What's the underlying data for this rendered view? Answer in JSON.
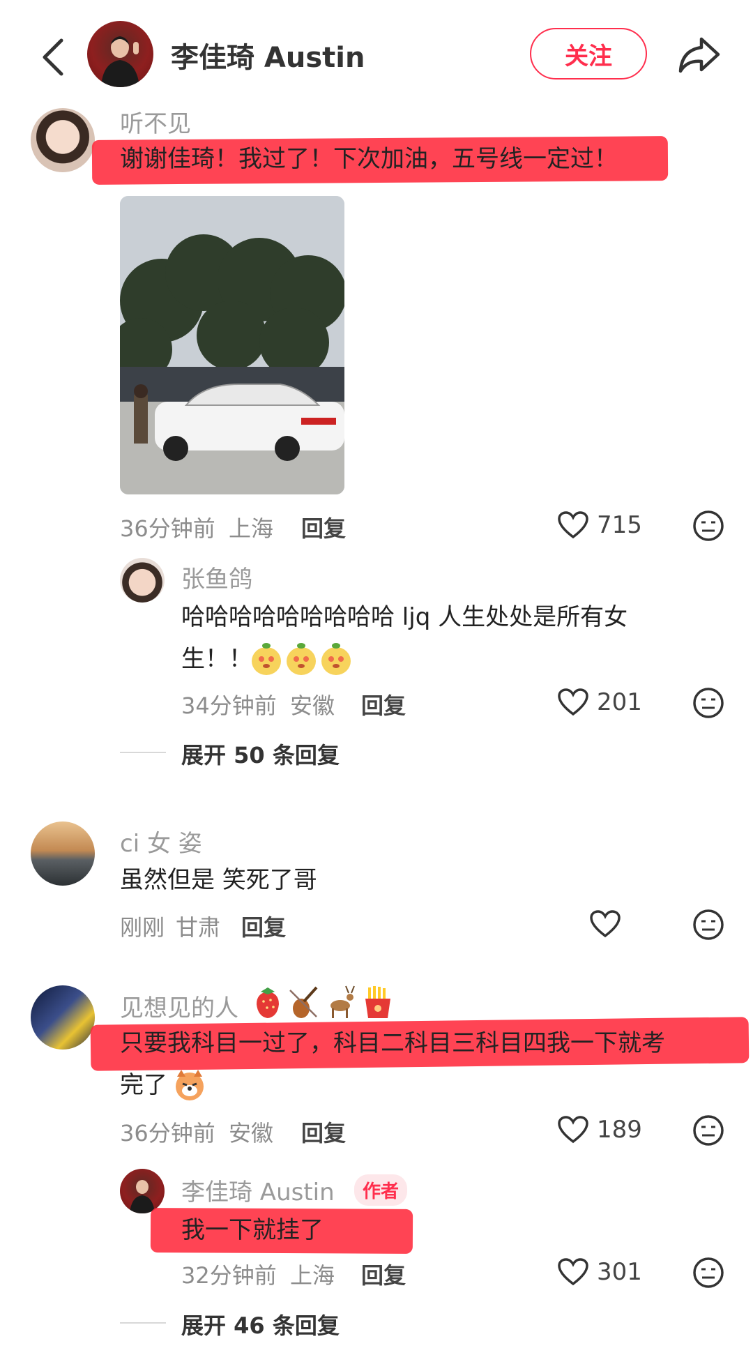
{
  "header": {
    "author_name": "李佳琦 Austin",
    "follow_label": "关注"
  },
  "colors": {
    "accent": "#ff2e4d",
    "highlight": "#ff2a3c"
  },
  "comments": [
    {
      "user": "听不见",
      "text": "谢谢佳琦！我过了！下次加油，五号线一定过！",
      "time": "36分钟前",
      "location": "上海",
      "reply_label": "回复",
      "likes": "715",
      "has_image": true,
      "replies": [
        {
          "user": "张鱼鸽",
          "text_line1": "哈哈哈哈哈哈哈哈哈 ljq 人生处处是所有女",
          "text_line2": "生！！",
          "time": "34分钟前",
          "location": "安徽",
          "reply_label": "回复",
          "likes": "201"
        }
      ],
      "expand_label": "展开 50 条回复"
    },
    {
      "user": "ci 女 姿",
      "text": "虽然但是 笑死了哥",
      "time": "刚刚",
      "location": "甘肃",
      "reply_label": "回复",
      "likes": ""
    },
    {
      "user": "见想见的人",
      "user_emojis": [
        "strawberry-icon",
        "violin-icon",
        "deer-icon",
        "fries-icon"
      ],
      "text_line1": "只要我科目一过了，科目二科目三科目四我一下就考",
      "text_line2": "完了",
      "time": "36分钟前",
      "location": "安徽",
      "reply_label": "回复",
      "likes": "189",
      "replies": [
        {
          "user": "李佳琦 Austin",
          "badge": "作者",
          "text": "我一下就挂了",
          "time": "32分钟前",
          "location": "上海",
          "reply_label": "回复",
          "likes": "301"
        }
      ],
      "expand_label": "展开 46 条回复"
    }
  ]
}
